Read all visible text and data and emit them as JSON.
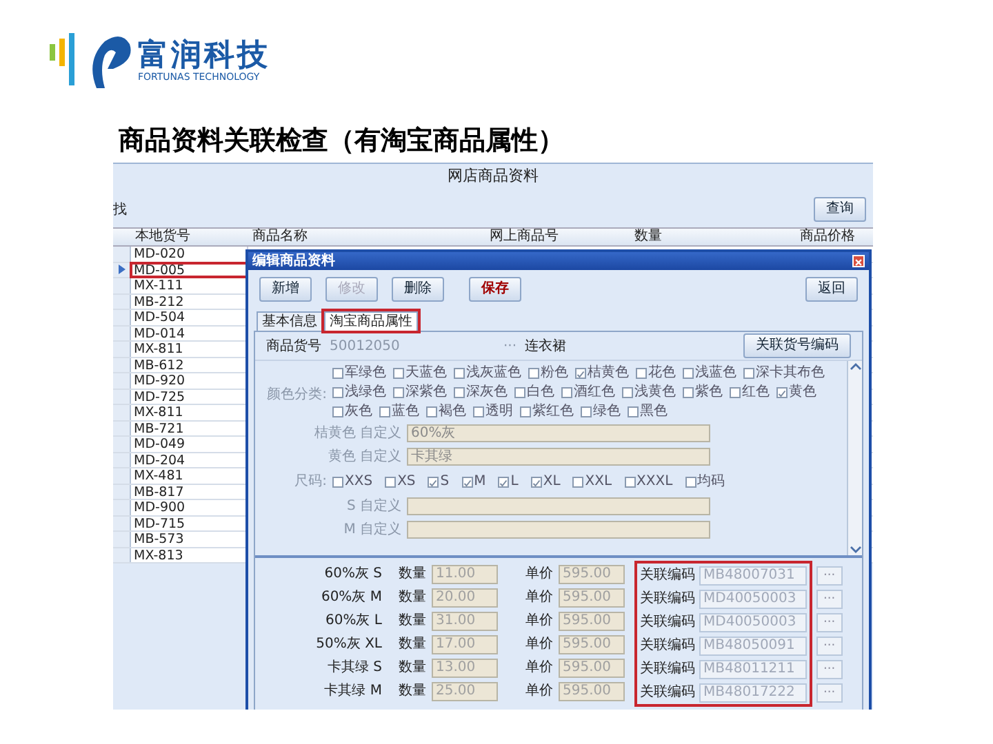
{
  "logo": {
    "name": "富润科技",
    "subtitle": "FORTUNAS TECHNOLOGY"
  },
  "slide_title": "商品资料关联检查（有淘宝商品属性）",
  "app": {
    "header": "网店商品资料",
    "filter_label": "找",
    "search_button": "查询",
    "columns": [
      "本地货号",
      "商品名称",
      "网上商品号",
      "数量",
      "商品价格"
    ],
    "rows": [
      {
        "code": "MD-020",
        "current": false,
        "highlighted": false
      },
      {
        "code": "MD-005",
        "current": true,
        "highlighted": true
      },
      {
        "code": "MX-111",
        "current": false,
        "highlighted": false
      },
      {
        "code": "MB-212",
        "current": false,
        "highlighted": false
      },
      {
        "code": "MD-504",
        "current": false,
        "highlighted": false
      },
      {
        "code": "MD-014",
        "current": false,
        "highlighted": false
      },
      {
        "code": "MX-811",
        "current": false,
        "highlighted": false
      },
      {
        "code": "MB-612",
        "current": false,
        "highlighted": false
      },
      {
        "code": "MD-920",
        "current": false,
        "highlighted": false
      },
      {
        "code": "MD-725",
        "current": false,
        "highlighted": false
      },
      {
        "code": "MX-811",
        "current": false,
        "highlighted": false
      },
      {
        "code": "MB-721",
        "current": false,
        "highlighted": false
      },
      {
        "code": "MD-049",
        "current": false,
        "highlighted": false
      },
      {
        "code": "MD-204",
        "current": false,
        "highlighted": false
      },
      {
        "code": "MX-481",
        "current": false,
        "highlighted": false
      },
      {
        "code": "MB-817",
        "current": false,
        "highlighted": false
      },
      {
        "code": "MD-900",
        "current": false,
        "highlighted": false
      },
      {
        "code": "MD-715",
        "current": false,
        "highlighted": false
      },
      {
        "code": "MB-573",
        "current": false,
        "highlighted": false
      },
      {
        "code": "MX-813",
        "current": false,
        "highlighted": false
      }
    ]
  },
  "dialog": {
    "title": "编辑商品资料",
    "toolbar": [
      {
        "label": "新增",
        "disabled": false,
        "kind": "normal"
      },
      {
        "label": "修改",
        "disabled": true,
        "kind": "normal"
      },
      {
        "label": "删除",
        "disabled": false,
        "kind": "normal"
      },
      {
        "label": "保存",
        "disabled": false,
        "kind": "primary"
      }
    ],
    "back_button": "返回",
    "tabs": [
      {
        "label": "基本信息",
        "selected": false,
        "highlighted": false
      },
      {
        "label": "淘宝商品属性",
        "selected": true,
        "highlighted": true
      }
    ],
    "item_code_label": "商品货号",
    "item_code": "50012050",
    "dots": "···",
    "category": "连衣裙",
    "link_button": "关联货号编码",
    "color_label": "颜色分类:",
    "colors": [
      {
        "label": "军绿色",
        "checked": false
      },
      {
        "label": "天蓝色",
        "checked": false
      },
      {
        "label": "浅灰蓝色",
        "checked": false
      },
      {
        "label": "粉色",
        "checked": false
      },
      {
        "label": "桔黄色",
        "checked": true
      },
      {
        "label": "花色",
        "checked": false
      },
      {
        "label": "浅蓝色",
        "checked": false
      },
      {
        "label": "深卡其布色",
        "checked": false
      },
      {
        "label": "浅绿色",
        "checked": false
      },
      {
        "label": "深紫色",
        "checked": false
      },
      {
        "label": "深灰色",
        "checked": false
      },
      {
        "label": "白色",
        "checked": false
      },
      {
        "label": "酒红色",
        "checked": false
      },
      {
        "label": "浅黄色",
        "checked": false
      },
      {
        "label": "紫色",
        "checked": false
      },
      {
        "label": "红色",
        "checked": false
      },
      {
        "label": "黄色",
        "checked": true
      },
      {
        "label": "灰色",
        "checked": false
      },
      {
        "label": "蓝色",
        "checked": false
      },
      {
        "label": "褐色",
        "checked": false
      },
      {
        "label": "透明",
        "checked": false
      },
      {
        "label": "紫红色",
        "checked": false
      },
      {
        "label": "绿色",
        "checked": false
      },
      {
        "label": "黑色",
        "checked": false
      }
    ],
    "custom_colors": [
      {
        "label": "桔黄色 自定义",
        "value": "60%灰"
      },
      {
        "label": "黄色 自定义",
        "value": "卡其绿"
      }
    ],
    "size_label": "尺码:",
    "sizes": [
      {
        "label": "XXS",
        "checked": false
      },
      {
        "label": "XS",
        "checked": false
      },
      {
        "label": "S",
        "checked": true
      },
      {
        "label": "M",
        "checked": true
      },
      {
        "label": "L",
        "checked": true
      },
      {
        "label": "XL",
        "checked": true
      },
      {
        "label": "XXL",
        "checked": false
      },
      {
        "label": "XXXL",
        "checked": false
      },
      {
        "label": "均码",
        "checked": false
      }
    ],
    "custom_sizes": [
      {
        "label": "S 自定义"
      },
      {
        "label": "M 自定义"
      }
    ],
    "codes_highlighted": true,
    "variants": [
      {
        "name": "60%灰 S",
        "qty_label": "数量",
        "qty": "11.00",
        "price_label": "单价",
        "price": "595.00",
        "code_label": "关联编码",
        "code": "MB48007031"
      },
      {
        "name": "60%灰 M",
        "qty_label": "数量",
        "qty": "20.00",
        "price_label": "单价",
        "price": "595.00",
        "code_label": "关联编码",
        "code": "MD40050003"
      },
      {
        "name": "60%灰 L",
        "qty_label": "数量",
        "qty": "31.00",
        "price_label": "单价",
        "price": "595.00",
        "code_label": "关联编码",
        "code": "MD40050003"
      },
      {
        "name": "50%灰 XL",
        "qty_label": "数量",
        "qty": "17.00",
        "price_label": "单价",
        "price": "595.00",
        "code_label": "关联编码",
        "code": "MB48050091"
      },
      {
        "name": "卡其绿 S",
        "qty_label": "数量",
        "qty": "13.00",
        "price_label": "单价",
        "price": "595.00",
        "code_label": "关联编码",
        "code": "MB48011211"
      },
      {
        "name": "卡其绿 M",
        "qty_label": "数量",
        "qty": "25.00",
        "price_label": "单价",
        "price": "595.00",
        "code_label": "关联编码",
        "code": "MB48017222"
      }
    ]
  }
}
